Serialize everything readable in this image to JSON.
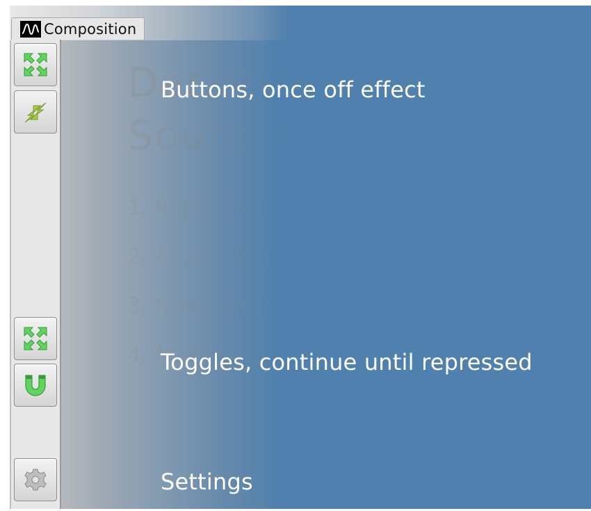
{
  "tab": {
    "label": "Composition",
    "icon": "waveform-icon"
  },
  "sidebar": {
    "buttons": [
      {
        "name": "expand-once-button",
        "icon": "expand-arrows-icon",
        "color": "#5fd45f"
      },
      {
        "name": "contract-once-button",
        "icon": "contract-arrows-icon",
        "color": "#a8c64a"
      },
      {
        "name": "expand-toggle-button",
        "icon": "expand-arrows-icon",
        "color": "#5fd45f"
      },
      {
        "name": "magnet-toggle-button",
        "icon": "magnet-icon",
        "color": "#5fd45f"
      },
      {
        "name": "settings-button",
        "icon": "gear-icon",
        "color": "#a0a0a0"
      }
    ]
  },
  "background_content": {
    "title_line1": "DarkArt",
    "title_line2": "Sound Ge",
    "items": [
      "1. Right-click",
      "2. Attach mod",
      "3. Now attach",
      "4. Make"
    ]
  },
  "callouts": {
    "buttons": "Buttons, once off effect",
    "toggles": "Toggles, continue until repressed",
    "settings": "Settings"
  },
  "colors": {
    "overlay_blue": "#5080ad",
    "callout_text": "#ffffff",
    "icon_green": "#5fd45f"
  }
}
